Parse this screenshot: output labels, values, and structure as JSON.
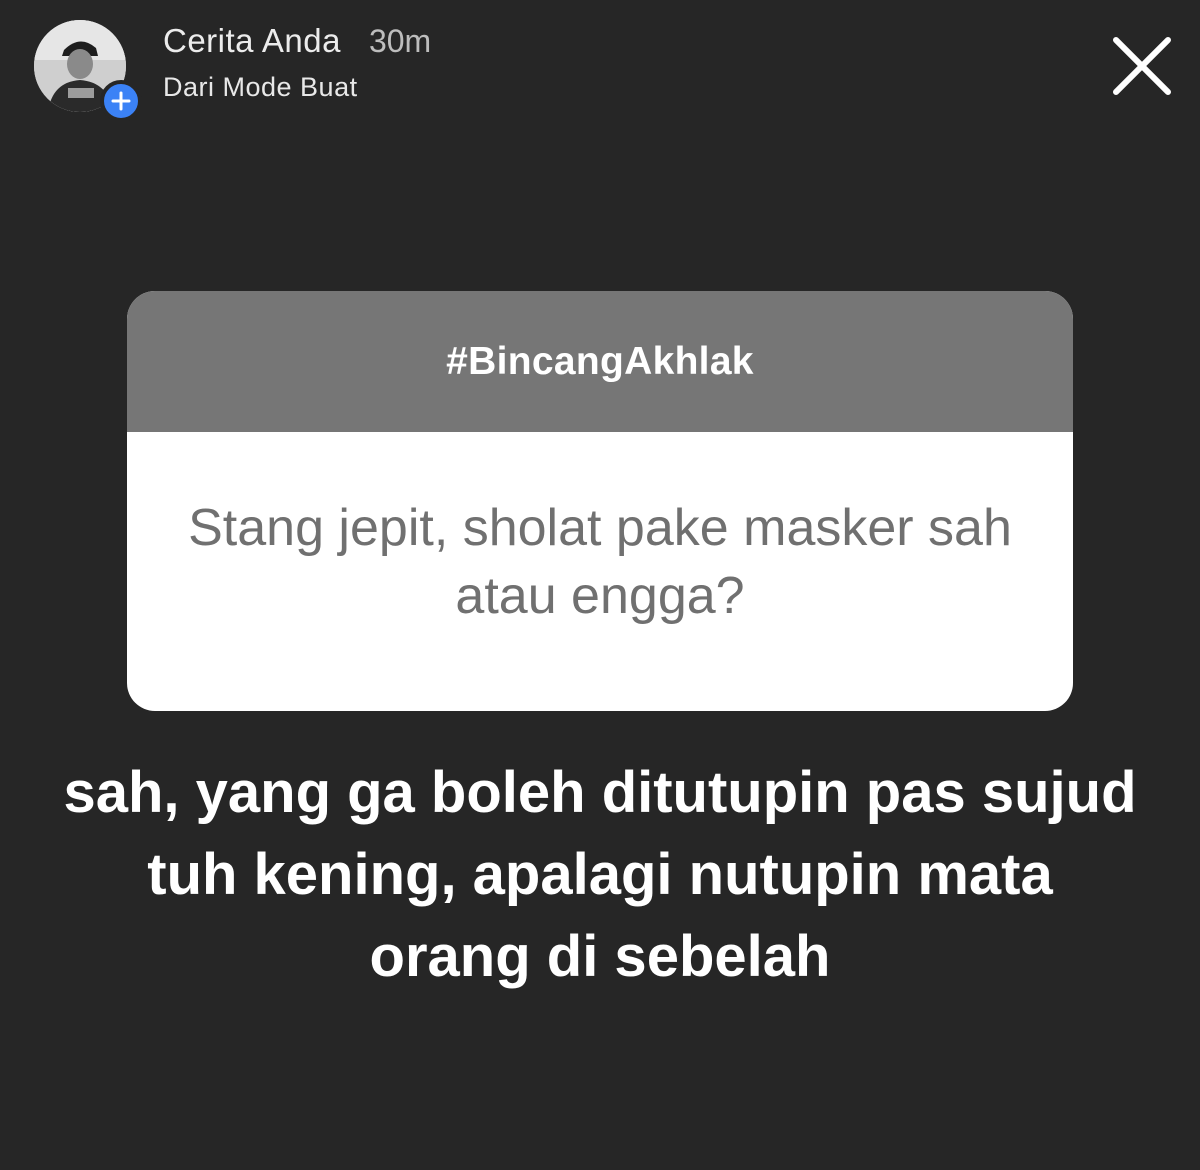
{
  "header": {
    "title": "Cerita Anda",
    "time": "30m",
    "subtitle": "Dari Mode Buat",
    "avatar_icon": "avatar-photo",
    "add_icon": "plus-circle-icon",
    "close_icon": "close-icon"
  },
  "question_card": {
    "tag": "#BincangAkhlak",
    "question": "Stang jepit, sholat pake masker sah atau engga?"
  },
  "answer": {
    "text": "sah, yang ga boleh ditutupin pas sujud tuh kening, apalagi nutupin mata orang di sebelah"
  },
  "colors": {
    "background": "#262626",
    "card_header": "#767676",
    "card_body": "#ffffff",
    "question_text": "#707070",
    "badge_blue": "#3b82f6"
  }
}
